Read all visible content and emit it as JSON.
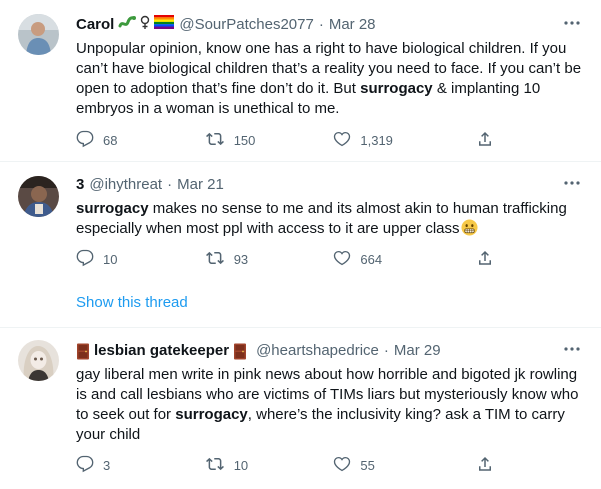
{
  "tweets": [
    {
      "display_name": "Carol",
      "name_decorations": [
        "snake-emoji",
        "gender-symbols-emoji",
        "rainbow-flag-emoji"
      ],
      "handle": "@SourPatches2077",
      "separator": "·",
      "time": "Mar 28",
      "text_segments": [
        {
          "text": "Unpopular opinion, know one has a right to have biological children. If you can’t have biological children that’s a reality you need to face. If you can’t be open to adoption that’s fine don’t do it. But ",
          "bold": false
        },
        {
          "text": "surrogacy",
          "bold": true
        },
        {
          "text": " & implanting 10 embryos in a woman is unethical to me.",
          "bold": false
        }
      ],
      "stats": {
        "replies": "68",
        "retweets": "150",
        "likes": "1,319"
      }
    },
    {
      "display_name": "3",
      "handle": "@ihythreat",
      "separator": "·",
      "time": "Mar 21",
      "text_segments": [
        {
          "text": "surrogacy",
          "bold": true
        },
        {
          "text": " makes no sense to me and its almost akin to human trafficking especially when most ppl with access to it are upper class",
          "bold": false
        }
      ],
      "trailing_emoji": "grimacing-face-emoji",
      "stats": {
        "replies": "10",
        "retweets": "93",
        "likes": "664"
      },
      "show_thread": "Show this thread"
    },
    {
      "display_name": "lesbian gatekeeper",
      "name_decorations": [
        "door-emoji",
        "door-emoji"
      ],
      "handle": "@heartshapedrice",
      "separator": "·",
      "time": "Mar 29",
      "text_segments": [
        {
          "text": "gay liberal men write in pink news about how horrible and bigoted jk rowling is and call lesbians who are victims of TIMs liars but mysteriously know who to seek out for ",
          "bold": false
        },
        {
          "text": "surrogacy",
          "bold": true
        },
        {
          "text": ", where’s the inclusivity king? ask a TIM to carry your child",
          "bold": false
        }
      ],
      "stats": {
        "replies": "3",
        "retweets": "10",
        "likes": "55"
      }
    }
  ],
  "colors": {
    "text": "#0f1419",
    "secondary": "#536471",
    "link": "#1d9bf0",
    "divider": "#eff3f4"
  }
}
